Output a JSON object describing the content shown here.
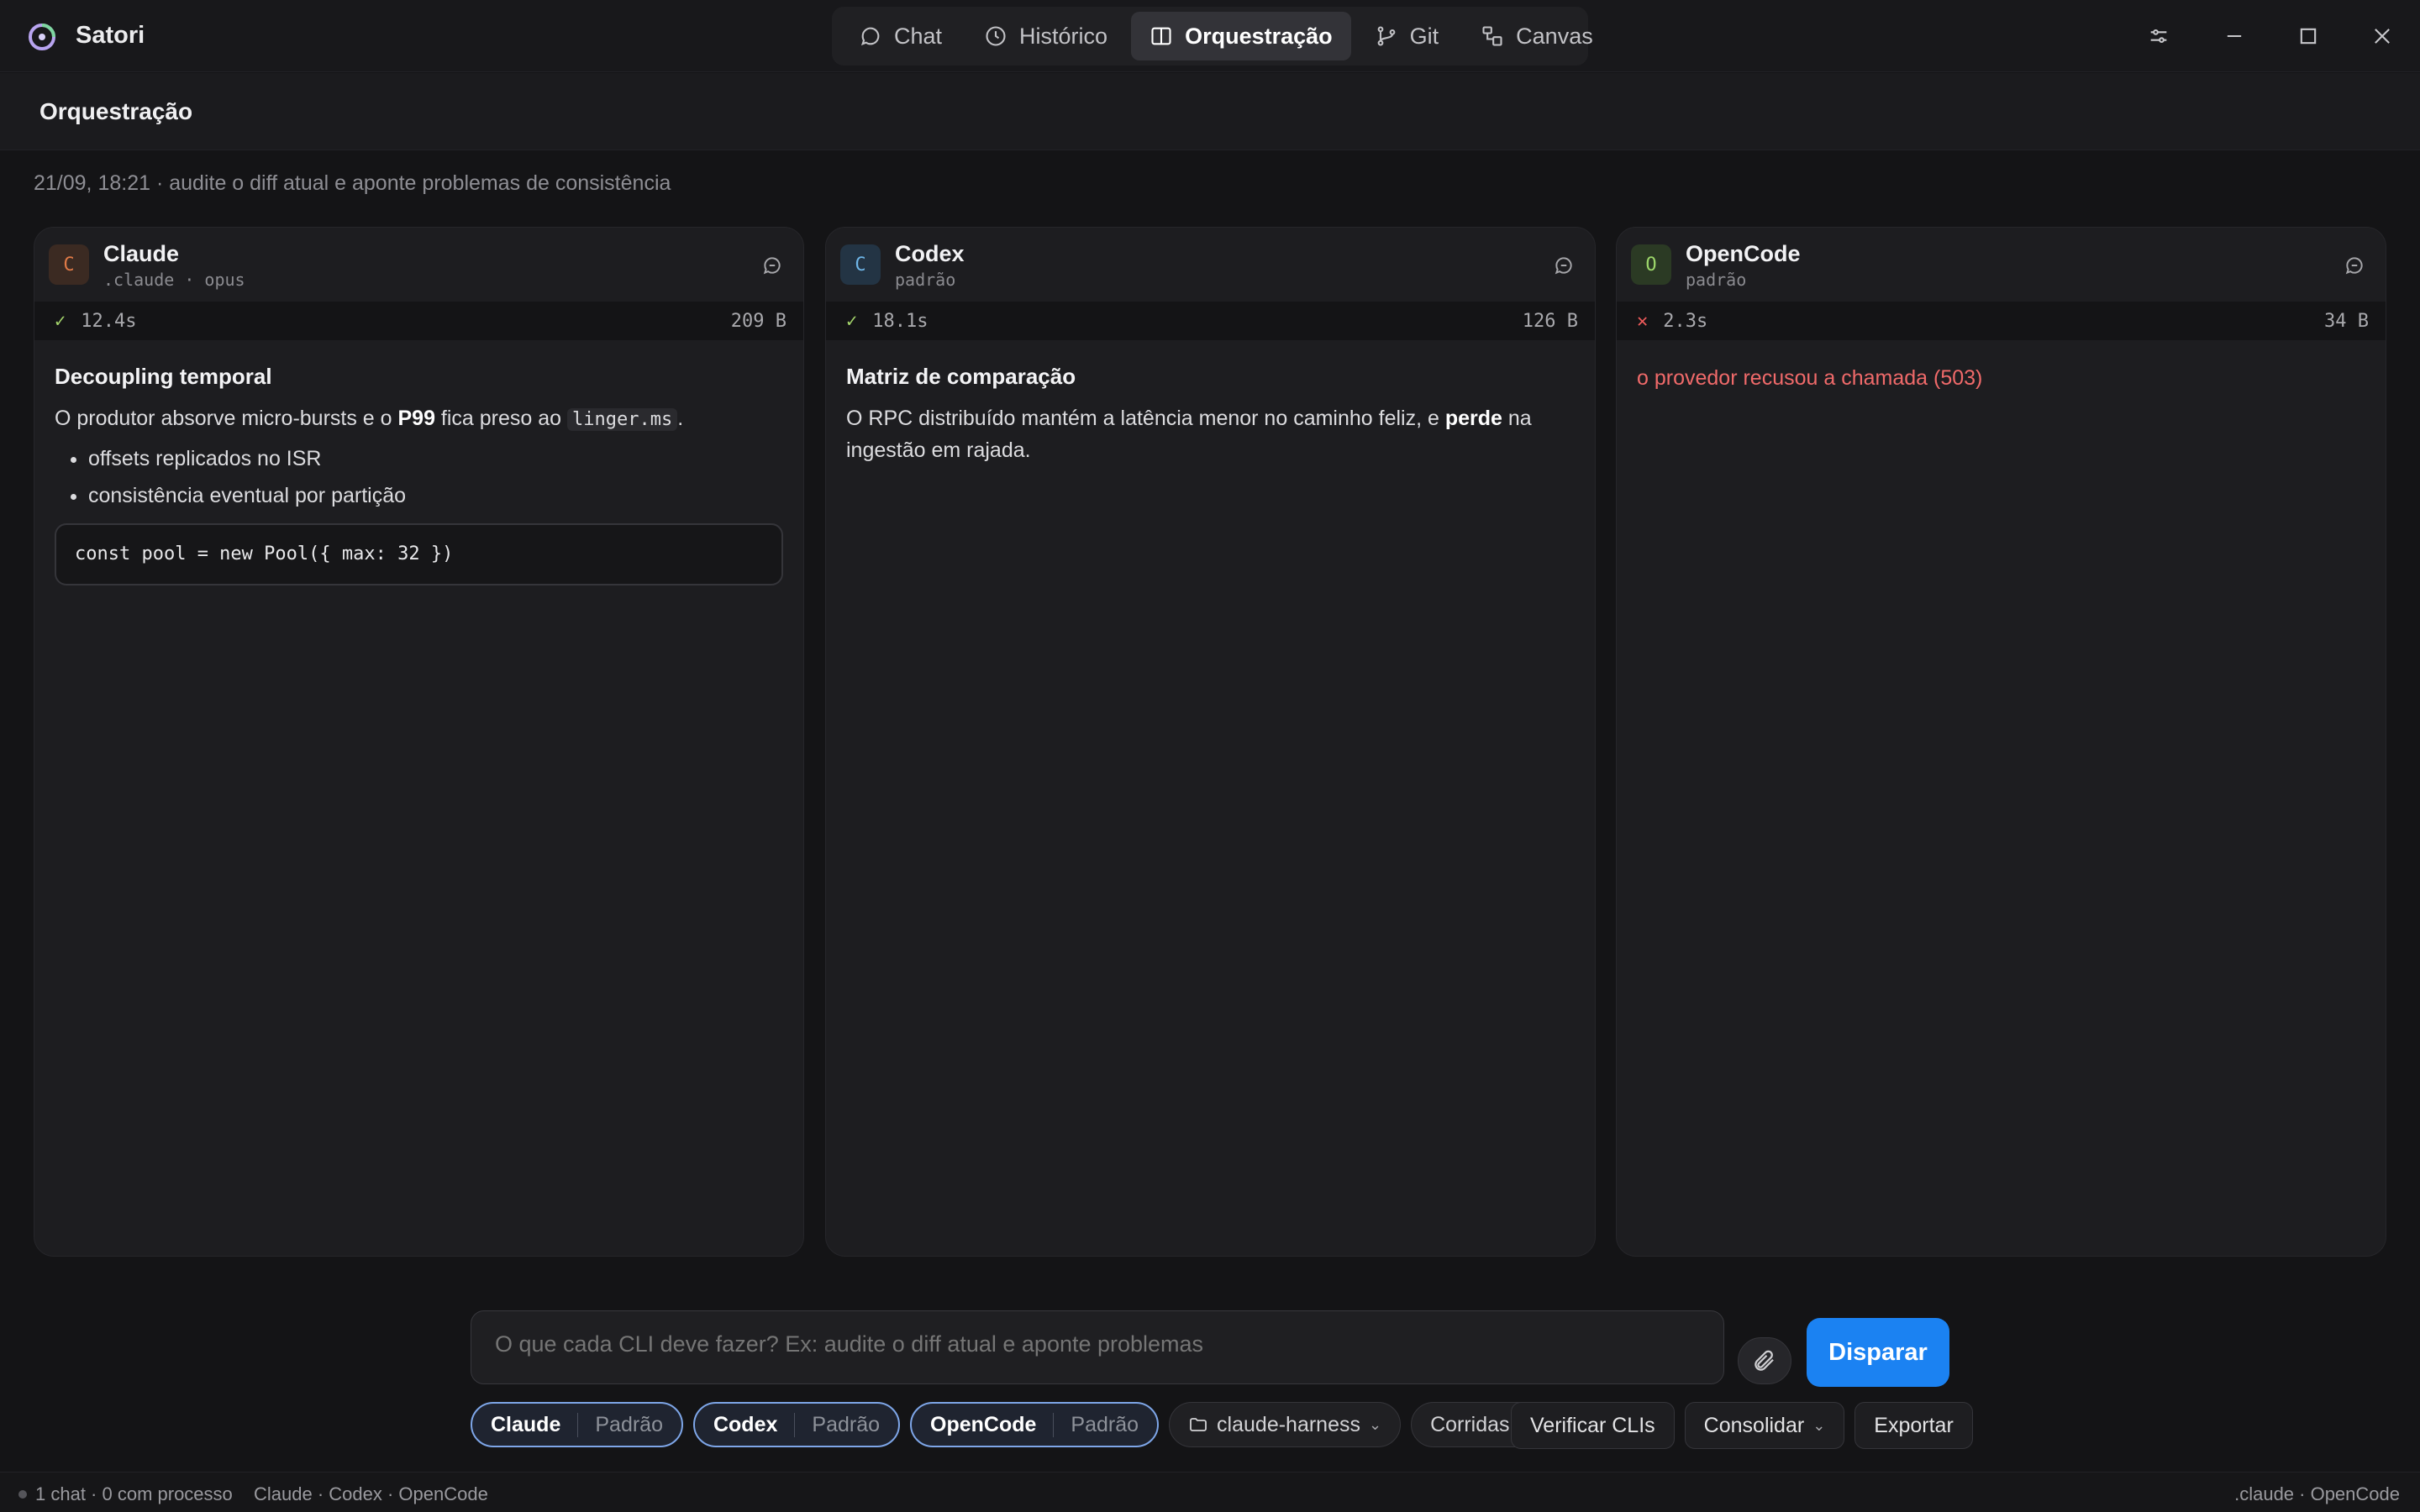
{
  "app": {
    "name": "Satori"
  },
  "nav": {
    "tabs": [
      {
        "label": "Chat",
        "icon": "chat-bubble-icon"
      },
      {
        "label": "Histórico",
        "icon": "clock-icon"
      },
      {
        "label": "Orquestração",
        "icon": "columns-icon",
        "active": true
      },
      {
        "label": "Git",
        "icon": "git-branch-icon"
      },
      {
        "label": "Canvas",
        "icon": "canvas-icon"
      }
    ]
  },
  "header": {
    "title": "Orquestração"
  },
  "run": {
    "meta": "21/09, 18:21 · audite o diff atual e aponte problemas de consistência"
  },
  "cards": [
    {
      "initial": "C",
      "name": "Claude",
      "sub": ".claude · opus",
      "status": "ok",
      "duration": "12.4s",
      "size": "209 B",
      "heading": "Decoupling temporal",
      "p1_before": "O produtor absorve micro-bursts e o ",
      "p1_bold": "P99",
      "p1_mid": " fica preso ao ",
      "p1_code": "linger.ms",
      "p1_after": ".",
      "bullets": [
        "offsets replicados no ISR",
        "consistência eventual por partição"
      ],
      "code": "const pool = new Pool({ max: 32 })"
    },
    {
      "initial": "C",
      "name": "Codex",
      "sub": "padrão",
      "status": "ok",
      "duration": "18.1s",
      "size": "126 B",
      "heading": "Matriz de comparação",
      "p1_before": "O RPC distribuído mantém a latência menor no caminho feliz, e ",
      "p1_bold": "perde",
      "p1_after": " na ingestão em rajada."
    },
    {
      "initial": "O",
      "name": "OpenCode",
      "sub": "padrão",
      "status": "error",
      "duration": "2.3s",
      "size": "34 B",
      "error": "o provedor recusou a chamada (503)"
    }
  ],
  "composer": {
    "placeholder": "O que cada CLI deve fazer? Ex: audite o diff atual e aponte problemas",
    "submit_label": "Disparar"
  },
  "controls": {
    "agents": [
      {
        "name": "Claude",
        "mode": "Padrão"
      },
      {
        "name": "Codex",
        "mode": "Padrão"
      },
      {
        "name": "OpenCode",
        "mode": "Padrão"
      }
    ],
    "workspace": "claude-harness",
    "runs": "Corridas",
    "verify": "Verificar CLIs",
    "consolidate": "Consolidar",
    "export": "Exportar"
  },
  "statusbar": {
    "left": "1 chat · 0 com processo",
    "agents": "Claude · Codex · OpenCode",
    "right": ".claude · OpenCode"
  },
  "colors": {
    "accent": "#1b82f2",
    "ok": "#a5d66c",
    "error": "#ef5b5b",
    "claude_avatar": "#e07a47",
    "codex_avatar": "#6fb6e8",
    "opencode_avatar": "#9cd66a"
  }
}
